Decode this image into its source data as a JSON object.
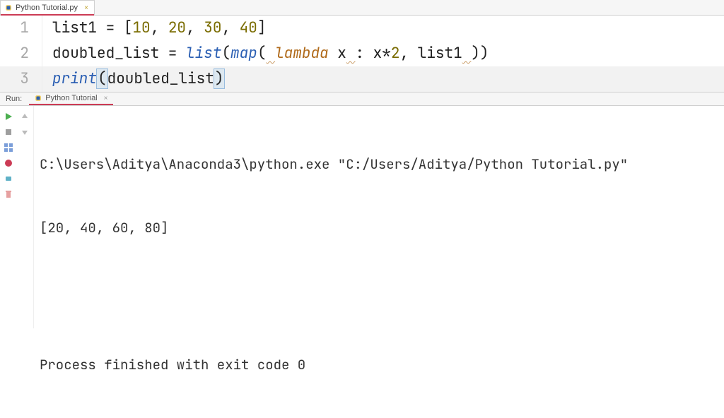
{
  "editorTab": {
    "fileName": "Python Tutorial.py"
  },
  "code": {
    "lines": {
      "l1": {
        "num": "1",
        "varName": "list1",
        "eq": " = ",
        "open": "[",
        "v1": "10",
        "c1": ", ",
        "v2": "20",
        "c2": ", ",
        "v3": "30",
        "c3": ", ",
        "v4": "40",
        "close": "]"
      },
      "l2": {
        "num": "2",
        "varName": "doubled_list",
        "eq": " = ",
        "listFn": "list",
        "lp1": "(",
        "mapFn": "map",
        "lp2": "(",
        "sp1": " ",
        "lambdaKw": "lambda",
        "lxPre": " x",
        "colonSp": " ",
        "colon": ": x*",
        "two": "2",
        "commaL": ", list1",
        "sp2": " ",
        "rp2": ")",
        "rp1": ")"
      },
      "l3": {
        "num": "3",
        "printFn": "print",
        "lp": "(",
        "arg": "doubled_list",
        "rp": ")"
      }
    }
  },
  "runPanel": {
    "label": "Run:",
    "configName": "Python Tutorial"
  },
  "console": {
    "cmdLine": "C:\\Users\\Aditya\\Anaconda3\\python.exe \"C:/Users/Aditya/Python Tutorial.py\"",
    "outputLine": "[20, 40, 60, 80]",
    "exitLine": "Process finished with exit code 0"
  }
}
